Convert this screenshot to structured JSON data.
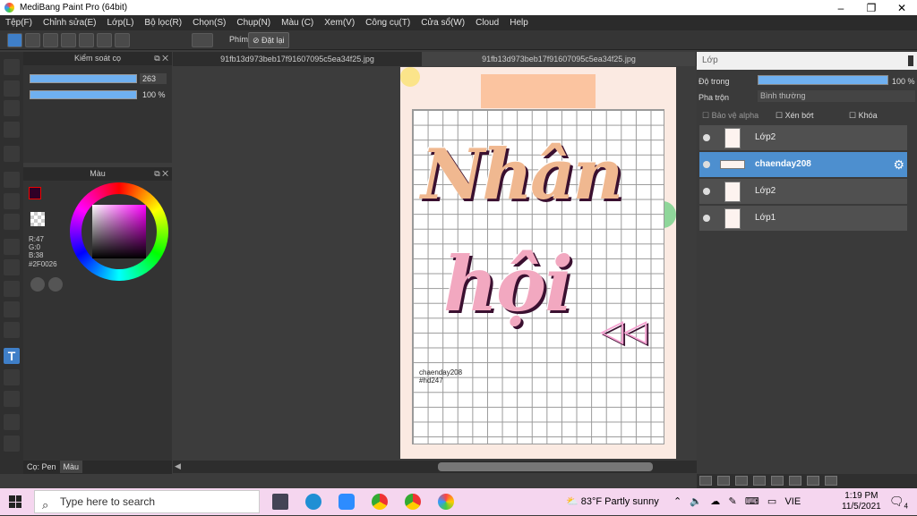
{
  "window": {
    "title": "MediBang Paint Pro (64bit)"
  },
  "menu": [
    "Tệp(F)",
    "Chỉnh sửa(E)",
    "Lớp(L)",
    "Bộ lọc(R)",
    "Chọn(S)",
    "Chụp(N)",
    "Màu (C)",
    "Xem(V)",
    "Công cụ(T)",
    "Cửa sổ(W)",
    "Cloud",
    "Help"
  ],
  "toolbar": {
    "phim_label": "Phím",
    "reset_label": "Đặt lại"
  },
  "brush_panel": {
    "title": "Kiểm soát cọ",
    "size_value": "263",
    "opacity_value": "100 %",
    "size_fraction": 1.0,
    "opacity_fraction": 1.0
  },
  "color_panel": {
    "title": "Màu",
    "r": "R:47",
    "g": "G:0",
    "b": "B:38",
    "hex": "#2F0026",
    "primary_color": "#2F0026"
  },
  "bottom_tabs": {
    "pen": "Cọ: Pen",
    "color": "Màu"
  },
  "doc_tabs": [
    "91fb13d973beb17f91607095c5ea34f25.jpg",
    "91fb13d973beb17f91607095c5ea34f25.jpg"
  ],
  "canvas": {
    "word1": "Nhân",
    "word2": "hội",
    "signature_line1": "chaenday208",
    "signature_line2": "#hd247"
  },
  "layer_panel": {
    "title": "Lớp",
    "opacity_label": "Độ trong",
    "opacity_value": "100 %",
    "opacity_fraction": 1.0,
    "blend_label": "Pha trộn",
    "blend_value": "Bình thường",
    "protect_alpha": "Bảo vệ alpha",
    "clip": "Xén bớt",
    "lock": "Khóa",
    "layers": [
      {
        "name": "Lớp2",
        "selected": false
      },
      {
        "name": "chaenday208",
        "selected": true
      },
      {
        "name": "Lớp2",
        "selected": false
      },
      {
        "name": "Lớp1",
        "selected": false
      }
    ]
  },
  "taskbar": {
    "search_placeholder": "Type here to search",
    "weather": "83°F  Partly sunny",
    "lang": "VIE",
    "time": "1:19 PM",
    "date": "11/5/2021",
    "notifications": "4"
  }
}
